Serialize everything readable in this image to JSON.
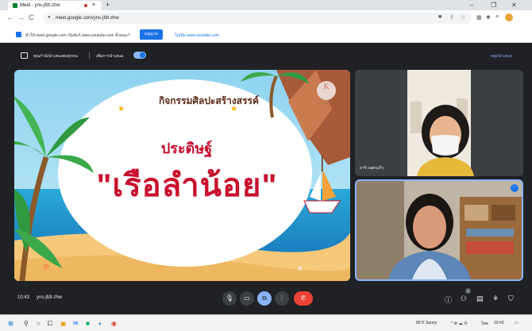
{
  "browser": {
    "tab_title": "Meet - yns-jfdt-zhw",
    "tab_close": "×",
    "new_tab": "+",
    "url": "meet.google.com/yns-jfdt-zhw",
    "win_min": "–",
    "win_max": "❐",
    "win_close": "✕"
  },
  "infobar": {
    "message": "ทำให้ meet.google.com เปิดลิงก์ www.youtube.com ทั้งหมด?",
    "allow_label": "อนุญาต",
    "deny_label": "ไม่เปิด www.youtube.com"
  },
  "meet_header": {
    "present_label": "คุณกำลังนำเสนอต่อทุกคน",
    "presenter_mode_label": "เพิ่มการนำเสนอ",
    "stop_label": "หยุดนำเสนอ"
  },
  "slide": {
    "heading": "กิจกรรมศิลปะสร้างสรรค์",
    "subheading": "ประดิษฐ์",
    "main_title": "\"เรือลำน้อย\"",
    "logo_letter": "K",
    "logo_text": "KINET"
  },
  "participants": [
    {
      "name": "ธาริ เนตรแก้ว"
    },
    {
      "name": ""
    }
  ],
  "controls": {
    "time": "10:43",
    "meeting_code": "yns-jfdt-zhw",
    "participant_count": "3"
  },
  "taskbar": {
    "weather": "85°F Sunny",
    "lang": "ไทย",
    "clock": "10:43"
  },
  "colors": {
    "meet_bg": "#202124",
    "accent": "#8ab4f8",
    "hangup": "#ea4335",
    "slide_red": "#c8102e"
  }
}
